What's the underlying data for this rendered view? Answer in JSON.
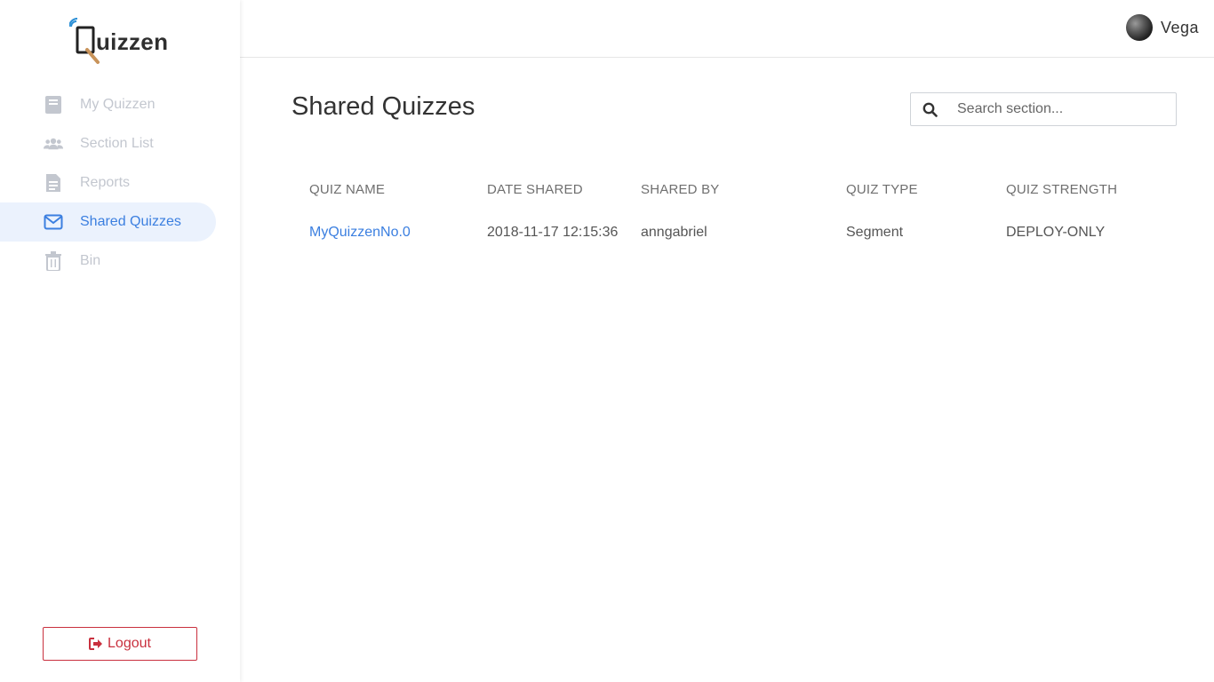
{
  "app": {
    "logo_text": "uizzen"
  },
  "sidebar": {
    "items": [
      {
        "label": "My Quizzen",
        "icon": "book-icon"
      },
      {
        "label": "Section List",
        "icon": "users-icon"
      },
      {
        "label": "Reports",
        "icon": "document-icon"
      },
      {
        "label": "Shared Quizzes",
        "icon": "envelope-icon",
        "active": true
      },
      {
        "label": "Bin",
        "icon": "trash-icon"
      }
    ],
    "logout_label": "Logout"
  },
  "header": {
    "user_name": "Vega"
  },
  "main": {
    "title": "Shared Quizzes",
    "search": {
      "placeholder": "Search section..."
    },
    "table": {
      "columns": [
        "QUIZ NAME",
        "DATE SHARED",
        "SHARED BY",
        "QUIZ TYPE",
        "QUIZ STRENGTH"
      ],
      "rows": [
        [
          "MyQuizzenNo.0",
          "2018-11-17 12:15:36",
          "anngabriel",
          "Segment",
          "DEPLOY-ONLY"
        ]
      ]
    }
  },
  "colors": {
    "accent": "#3b7fe0",
    "active_bg": "#ebf2fd",
    "inactive": "#c3c7cf",
    "danger": "#c9303e"
  }
}
